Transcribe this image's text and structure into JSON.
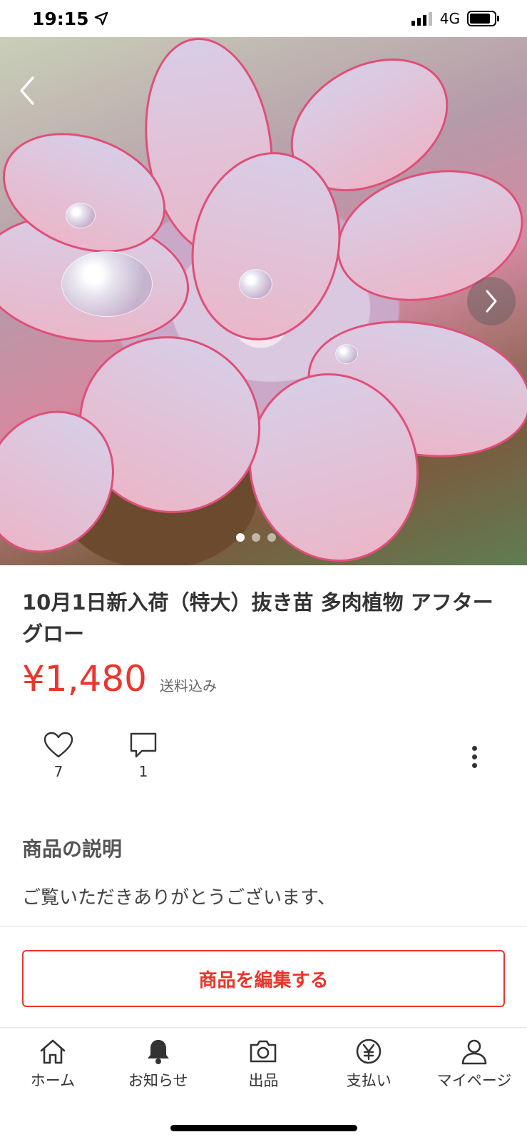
{
  "status_bar": {
    "time": "19:15",
    "network": "4G"
  },
  "product": {
    "title": "10月1日新入荷（特大）抜き苗 多肉植物 アフターグロー",
    "price": "¥1,480",
    "shipping": "送料込み",
    "likes": "7",
    "comments": "1"
  },
  "description": {
    "heading": "商品の説明",
    "text": "ご覧いただきありがとうございます、"
  },
  "edit_button_label": "商品を編集する",
  "tabbar": {
    "home": "ホーム",
    "notifications": "お知らせ",
    "sell": "出品",
    "payment": "支払い",
    "mypage": "マイページ"
  },
  "carousel": {
    "current_index": 1,
    "total": 3
  },
  "colors": {
    "accent": "#ea352d",
    "text": "#333333"
  }
}
